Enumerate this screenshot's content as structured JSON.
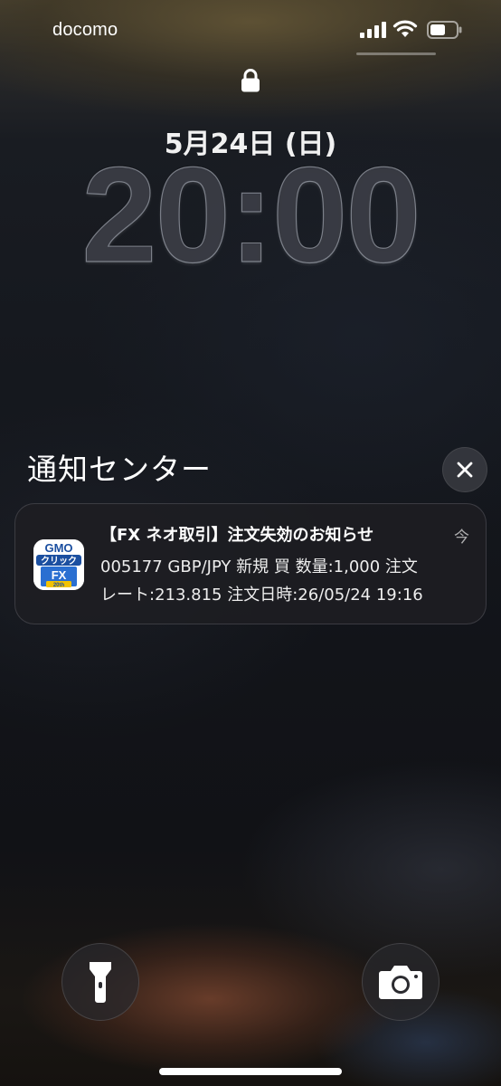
{
  "status_bar": {
    "carrier": "docomo",
    "icons": [
      "signal-icon",
      "wifi-icon",
      "battery-icon"
    ]
  },
  "lock_screen": {
    "lock_icon": "lock-icon",
    "date": "5月24日 (日)",
    "time": "20:00"
  },
  "notification_center": {
    "title": "通知センター",
    "clear_icon": "close-icon"
  },
  "notifications": [
    {
      "app_icon": "gmo-click-fx-app-icon",
      "title": "【FX ネオ取引】注文失効のお知らせ",
      "time": "今",
      "body_line1": "005177 GBP/JPY 新規 買 数量:1,000 注文",
      "body_line2": "レート:213.815 注文日時:26/05/24 19:16"
    }
  ],
  "quick_actions": {
    "flashlight_icon": "flashlight-icon",
    "camera_icon": "camera-icon"
  },
  "app_icon_text": {
    "brand": "GMO",
    "line1": "クリック",
    "line2": "FX",
    "badge": "20th"
  }
}
